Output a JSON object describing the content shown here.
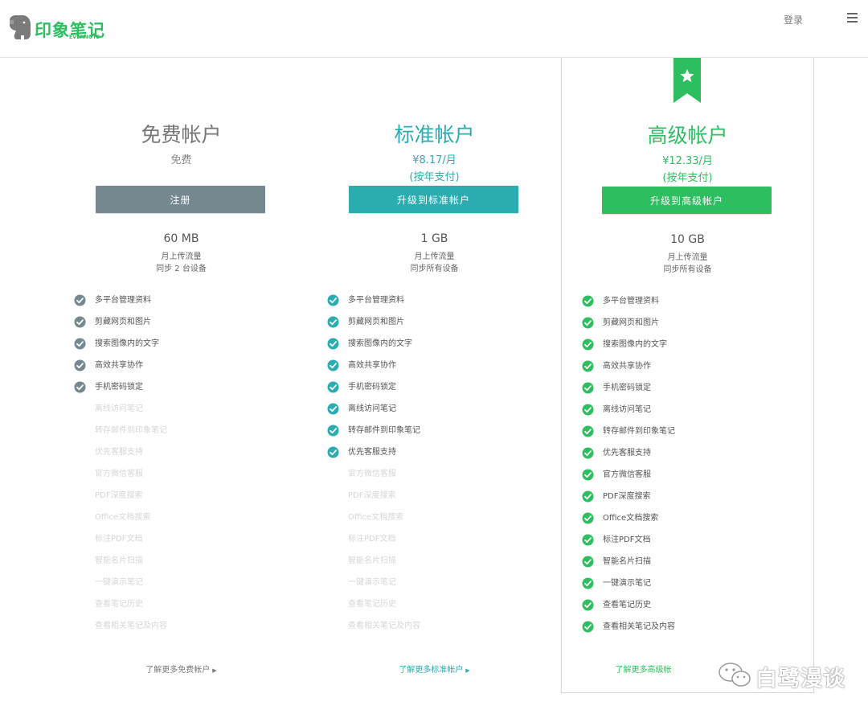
{
  "header": {
    "logo_text": "印象笔记",
    "logo_sub": "EVERNOTE",
    "login": "登录"
  },
  "plans": [
    {
      "title": "免费帐户",
      "price": "免费",
      "billing": "",
      "button": "注册",
      "storage": "60 MB",
      "storage_note1": "月上传流量",
      "storage_note2": "同步 2 台设备",
      "more_link": "了解更多免费帐户",
      "accent": "#76888f"
    },
    {
      "title": "标准帐户",
      "price": "¥8.17/月",
      "billing": "(按年支付)",
      "button": "升级到标准帐户",
      "storage": "1 GB",
      "storage_note1": "月上传流量",
      "storage_note2": "同步所有设备",
      "more_link": "了解更多标准帐户",
      "accent": "#2aacb0"
    },
    {
      "title": "高级帐户",
      "price": "¥12.33/月",
      "billing": "(按年支付)",
      "button": "升级到高级帐户",
      "storage": "10 GB",
      "storage_note1": "月上传流量",
      "storage_note2": "同步所有设备",
      "more_link": "了解更多高级帐",
      "accent": "#2dbe60"
    }
  ],
  "features": [
    "多平台管理资料",
    "剪藏网页和图片",
    "搜索图像内的文字",
    "高效共享协作",
    "手机密码锁定",
    "离线访问笔记",
    "转存邮件到印象笔记",
    "优先客服支持",
    "官方微信客服",
    "PDF深度搜索",
    "Office文档搜索",
    "标注PDF文档",
    "智能名片扫描",
    "一键演示笔记",
    "查看笔记历史",
    "查看相关笔记及内容"
  ],
  "included_counts": [
    5,
    8,
    16
  ],
  "watermark": "白鹭漫谈",
  "icons": {
    "logo": "elephant-icon",
    "menu": "hamburger-menu-icon",
    "check": "check-circle-icon",
    "ribbon": "star-ribbon-icon",
    "arrow": "triangle-right-icon",
    "watermark": "wechat-icon"
  }
}
